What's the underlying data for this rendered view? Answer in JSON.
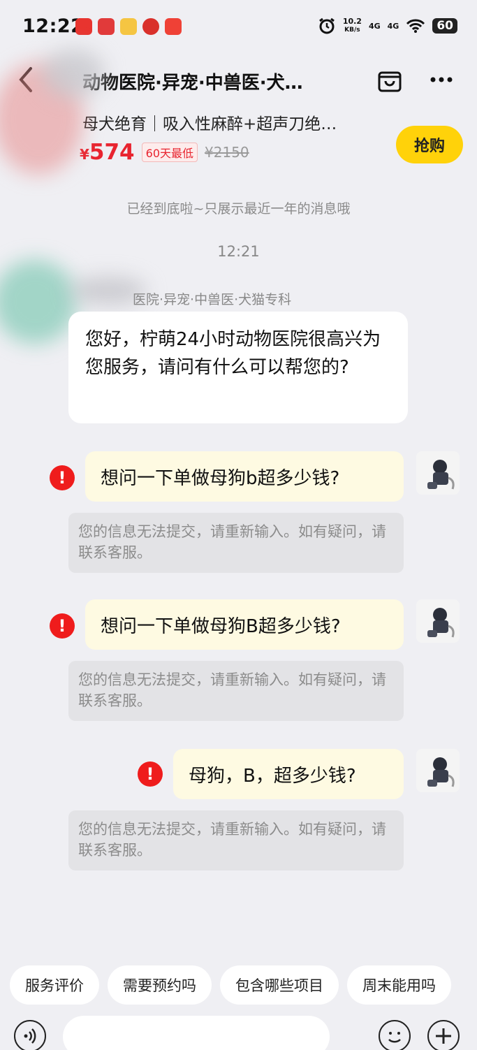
{
  "status_bar": {
    "time": "12:22",
    "net_speed_value": "10.2",
    "net_speed_unit": "KB/s",
    "signal_1": "4G",
    "signal_2": "4G",
    "battery": "60"
  },
  "header": {
    "title": "动物医院·异宠·中兽医·犬…",
    "product_name": "母犬绝育｜吸入性麻醉+超声刀绝…",
    "price_currency": "¥",
    "price_value": "574",
    "price_badge": "60天最低",
    "old_price": "¥2150",
    "buy_label": "抢购"
  },
  "chat": {
    "system_note": "已经到底啦~只展示最近一年的消息哦",
    "timestamp": "12:21",
    "merchant_name": "医院·异宠·中兽医·犬猫专科",
    "greeting": "您好，柠萌24小时动物医院很高兴为您服务，请问有什么可以帮您的?",
    "messages": [
      {
        "text": "想问一下单做母狗b超多少钱?",
        "error": "您的信息无法提交，请重新输入。如有疑问，请联系客服。"
      },
      {
        "text": "想问一下单做母狗B超多少钱?",
        "error": "您的信息无法提交，请重新输入。如有疑问，请联系客服。"
      },
      {
        "text": "母狗，B，超多少钱?",
        "error": "您的信息无法提交，请重新输入。如有疑问，请联系客服。"
      }
    ],
    "error_mark": "!"
  },
  "quick_replies": [
    "服务评价",
    "需要预约吗",
    "包含哪些项目",
    "周末能用吗"
  ],
  "colors": {
    "price_red": "#e8242f",
    "buy_yellow": "#ffd20a",
    "error_red": "#ef1c1c",
    "outgoing_bubble": "#fefae2"
  },
  "icons": [
    "back-icon",
    "store-icon",
    "more-icon",
    "voice-icon",
    "emoji-icon",
    "plus-icon",
    "alarm-icon",
    "wifi-icon"
  ]
}
